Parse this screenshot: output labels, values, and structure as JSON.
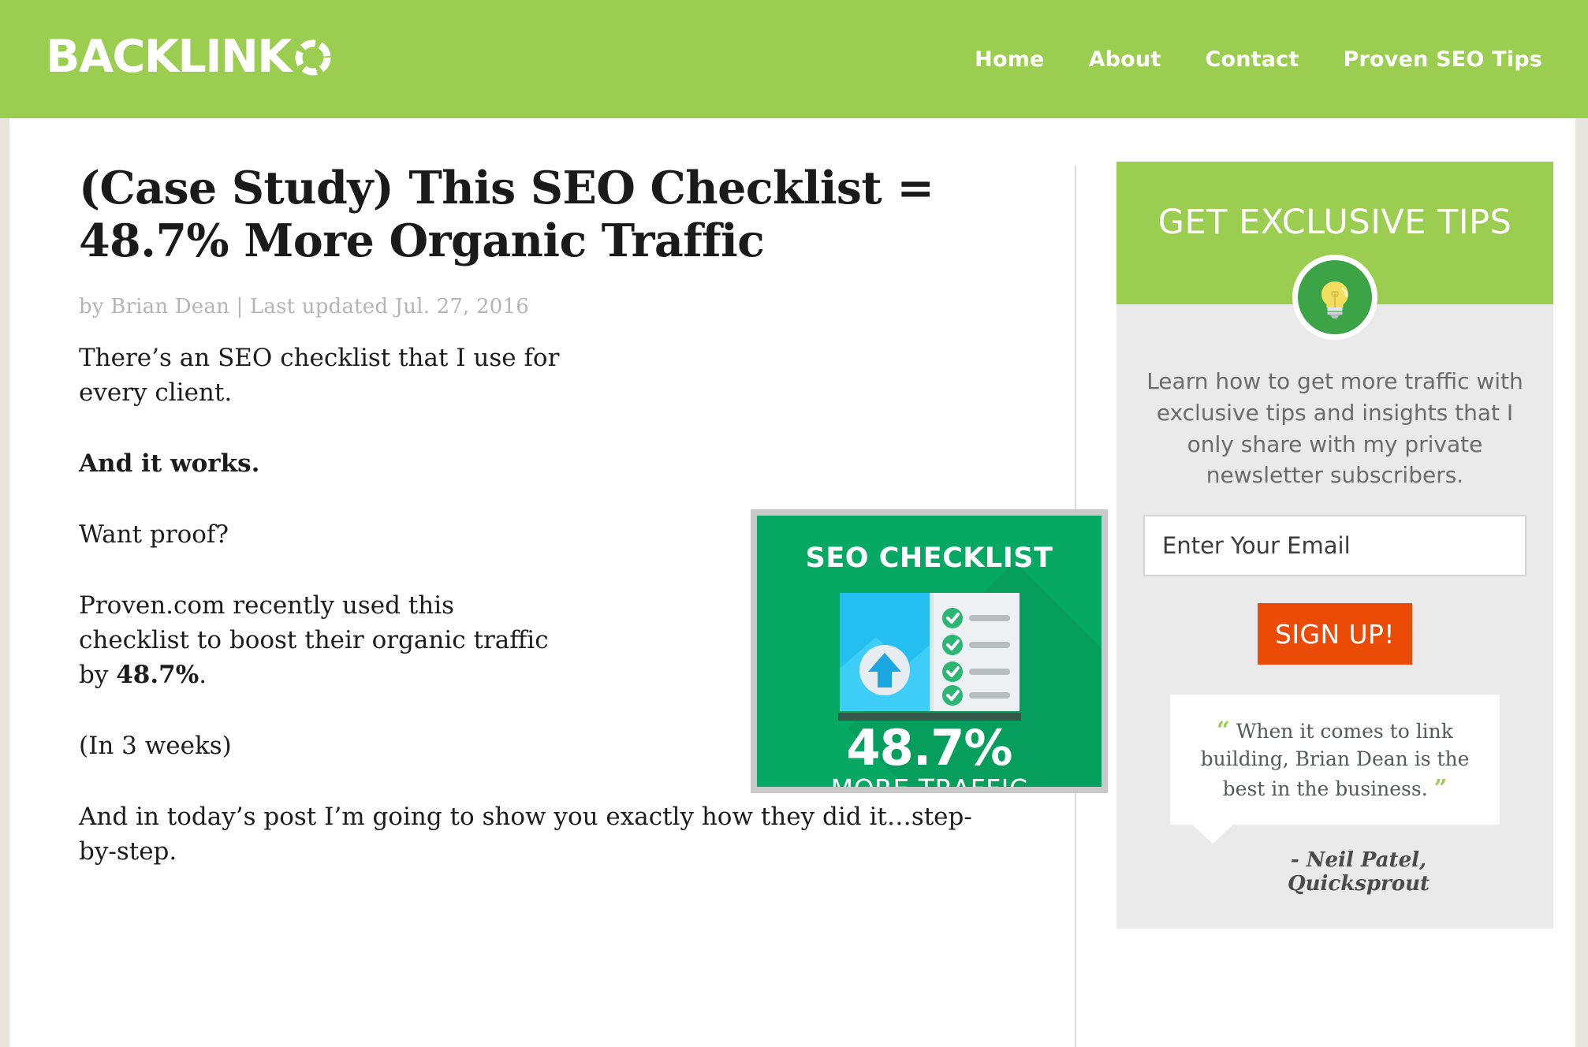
{
  "header": {
    "logo_text": "BACKLINK",
    "logo_mark": "dashed-circle-o-icon",
    "brand_green": "#9acd50",
    "nav": [
      {
        "label": "Home"
      },
      {
        "label": "About"
      },
      {
        "label": "Contact"
      },
      {
        "label": "Proven SEO Tips"
      }
    ]
  },
  "article": {
    "title": "(Case Study) This SEO Checklist = 48.7% More Organic Traffic",
    "byline": "by Brian Dean | Last updated Jul. 27, 2016",
    "author": "Brian Dean",
    "last_updated": "Jul. 27, 2016",
    "paragraphs": [
      {
        "id": "p1",
        "text": "There’s an SEO checklist that I use for every client.",
        "style": "narrow"
      },
      {
        "id": "p2",
        "text": "And it works.",
        "style": "narrow bold"
      },
      {
        "id": "p3",
        "text": "Want proof?",
        "style": "narrow"
      },
      {
        "id": "p4",
        "text": "Proven.com recently used this checklist to boost their organic traffic by ",
        "bold_tail": "48.7%",
        "tail": ".",
        "style": "narrow"
      },
      {
        "id": "p5",
        "text": "(In 3 weeks)",
        "style": "narrow"
      },
      {
        "id": "p6",
        "text": "And in today’s post I’m going to show you exactly how they did it…step-by-step.",
        "style": "wide"
      }
    ]
  },
  "featured_image": {
    "title": "SEO CHECKLIST",
    "stat": "48.7%",
    "subtitle": "MORE TRAFFIC",
    "bg_color": "#06a863",
    "frame_color": "#c9c9c9",
    "icon": "open-book-checklist-icon",
    "checkmark_count": 4
  },
  "sidebar": {
    "optin": {
      "heading": "GET EXCLUSIVE TIPS",
      "icon": "lightbulb-icon",
      "description": "Learn how to get more traffic with exclusive tips and insights that I only share with my private newsletter subscribers.",
      "email_placeholder": "Enter Your Email",
      "email_value": "",
      "submit_label": "SIGN UP!",
      "submit_color": "#ea4b06"
    },
    "testimonial": {
      "open_quote": "“",
      "close_quote": "”",
      "quote": "When it comes to link building, Brian Dean is the best in the business.",
      "author": "- Neil Patel, Quicksprout"
    }
  }
}
